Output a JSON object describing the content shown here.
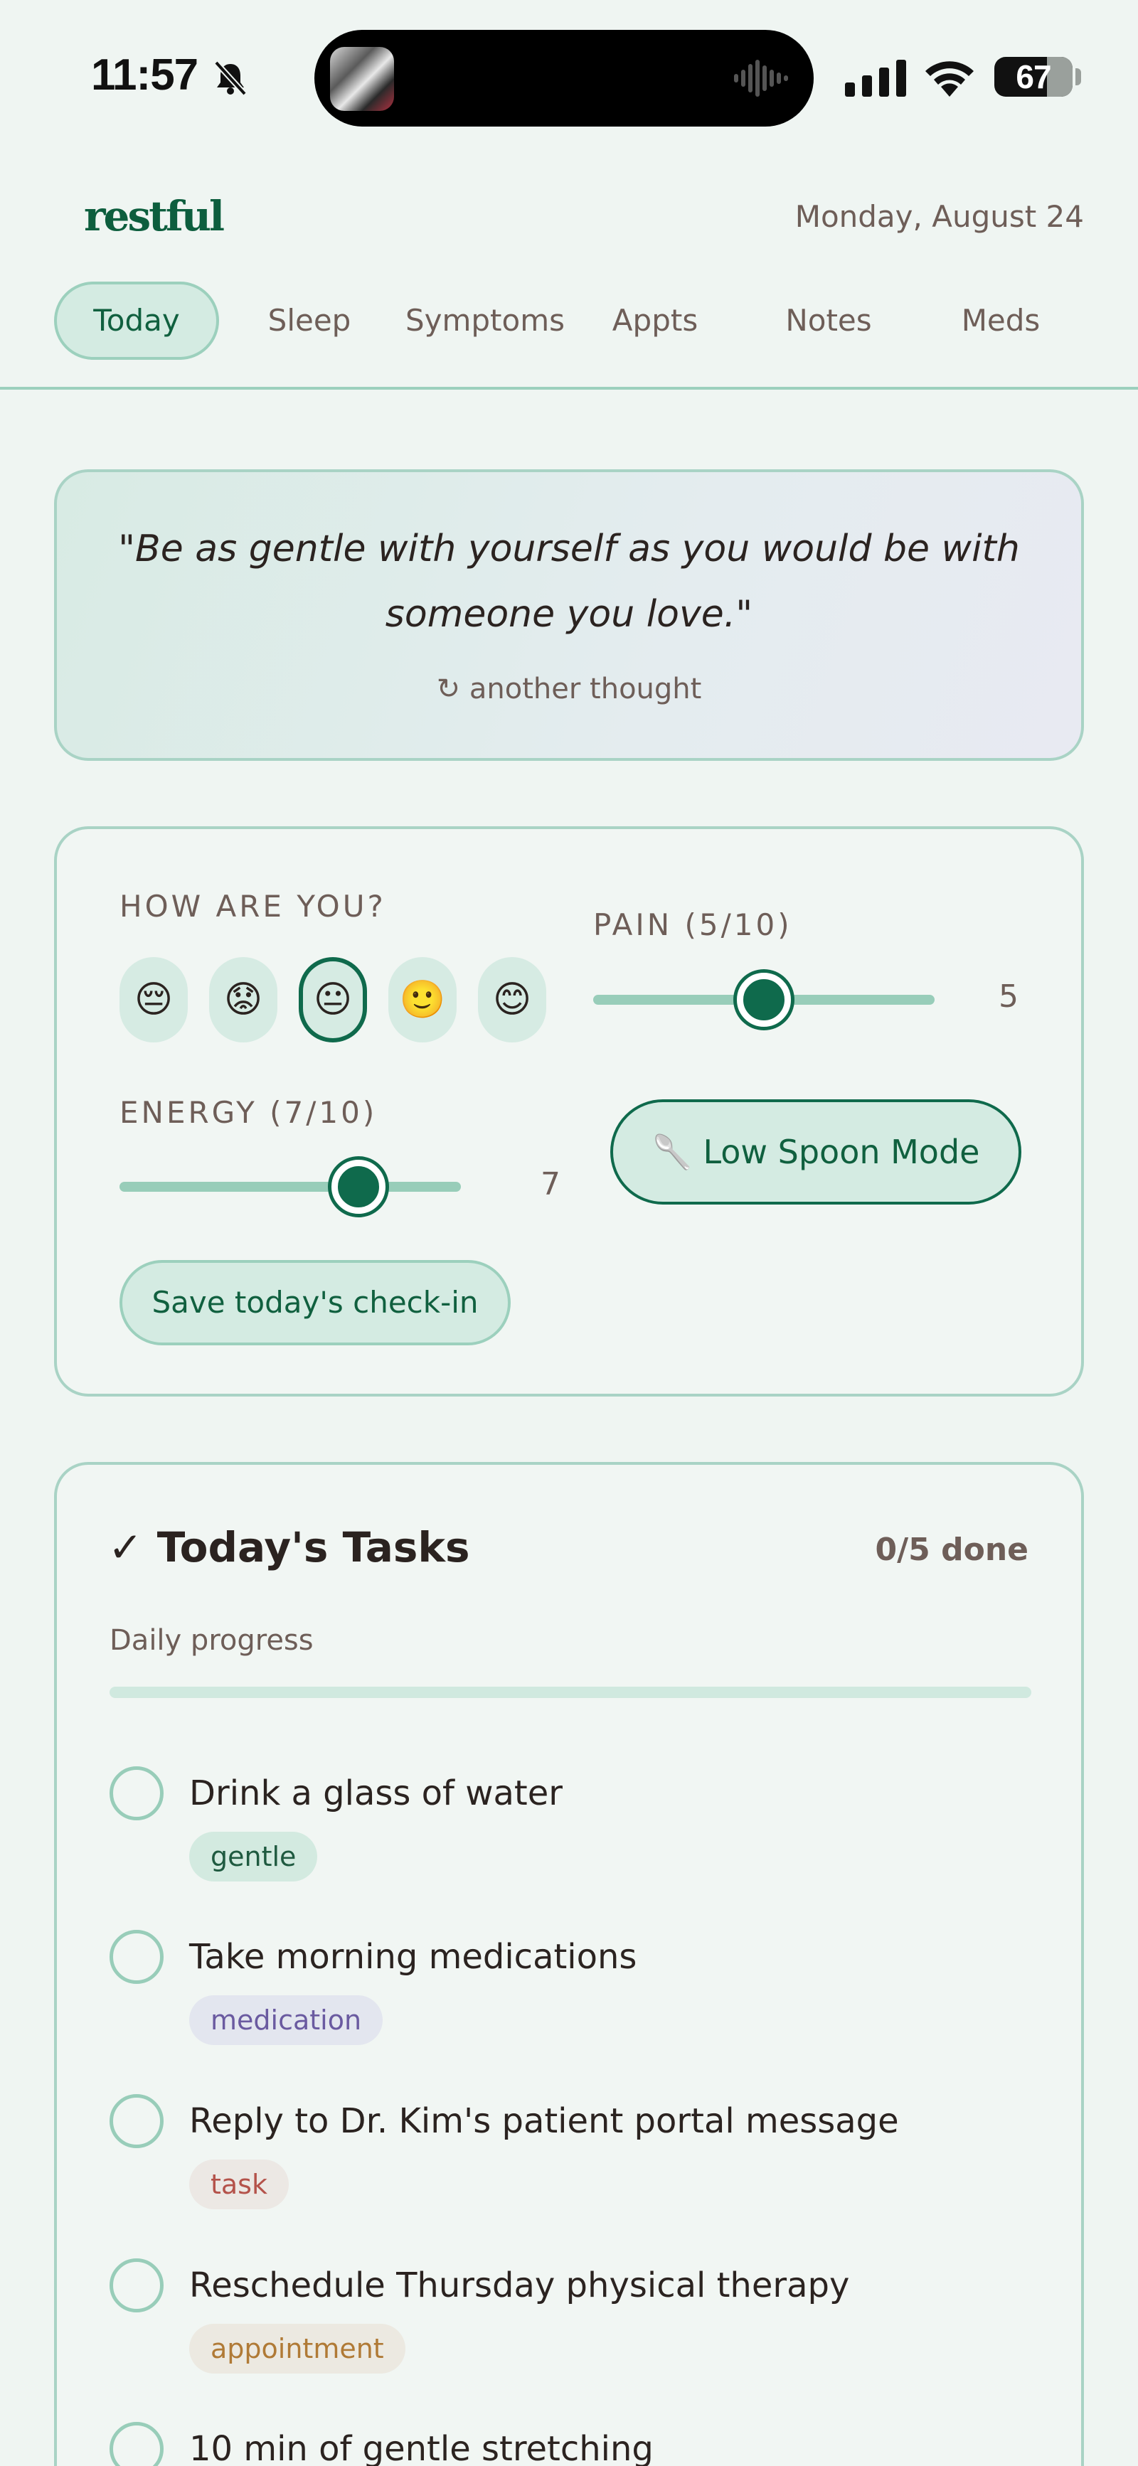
{
  "status_bar": {
    "time": "11:57",
    "battery": "67",
    "battery_level": 0.67
  },
  "header": {
    "logo": "restful",
    "date": "Monday, August 24"
  },
  "tabs": [
    {
      "label": "Today",
      "active": true
    },
    {
      "label": "Sleep",
      "active": false
    },
    {
      "label": "Symptoms",
      "active": false
    },
    {
      "label": "Appts",
      "active": false
    },
    {
      "label": "Notes",
      "active": false
    },
    {
      "label": "Meds",
      "active": false
    }
  ],
  "quote": {
    "text": "\"Be as gentle with yourself as you would be with someone you love.\"",
    "refresh_label": "↻ another thought"
  },
  "checkin": {
    "mood_label": "HOW ARE YOU?",
    "moods": [
      "😔",
      "😟",
      "😐",
      "🙂",
      "😊"
    ],
    "selected_mood": 2,
    "pain_label": "PAIN (5/10)",
    "pain_value": "5",
    "pain_level": 5,
    "energy_label": "ENERGY (7/10)",
    "energy_value": "7",
    "energy_level": 7,
    "slider_max": 10,
    "spoon_button": "🥄 Low Spoon Mode",
    "save_button": "Save today's check-in"
  },
  "tasks": {
    "title": "✓ Today's Tasks",
    "count": "0/5 done",
    "progress_label": "Daily progress",
    "progress": 0,
    "items": [
      {
        "text": "Drink a glass of water",
        "tag": "gentle"
      },
      {
        "text": "Take morning medications",
        "tag": "medication"
      },
      {
        "text": "Reply to Dr. Kim's patient portal message",
        "tag": "task"
      },
      {
        "text": "Reschedule Thursday physical therapy",
        "tag": "appointment"
      },
      {
        "text": "10 min of gentle stretching",
        "tag": ""
      }
    ]
  },
  "tag_colors": {
    "gentle": {
      "bg": "#d3eae0",
      "fg": "#1f5a40"
    },
    "medication": {
      "bg": "#e3e6ef",
      "fg": "#6a5aa0"
    },
    "task": {
      "bg": "#ece8e4",
      "fg": "#b4524a"
    },
    "appointment": {
      "bg": "#ece9e1",
      "fg": "#b07a36"
    }
  },
  "colors": {
    "accent": "#0f6a4c",
    "track": "#98cdb9",
    "background": "#eff5f2"
  }
}
